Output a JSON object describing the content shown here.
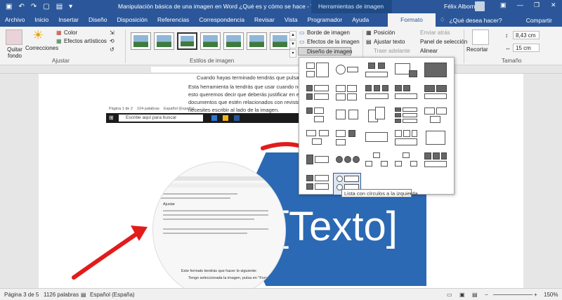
{
  "window": {
    "title": "Manipulación básica de una imagen en Word ¿Qué es y cómo se hace - Word",
    "context_tools": "Herramientas de imagen",
    "user": "Félix Albornoz"
  },
  "tabs": [
    "Archivo",
    "Inicio",
    "Insertar",
    "Diseño",
    "Disposición",
    "Referencias",
    "Correspondencia",
    "Revisar",
    "Vista",
    "Programador",
    "Ayuda",
    "Formato"
  ],
  "tab_search": "¿Qué desea hacer?",
  "share": "Compartir",
  "ribbon": {
    "quitar_fondo": [
      "Quitar",
      "fondo"
    ],
    "correcciones": "Correcciones",
    "color": "Color",
    "efectos_artisticos": "Efectos artísticos",
    "ajustar_label": "Ajustar",
    "estilos_label": "Estilos de imagen",
    "borde_imagen": "Borde de imagen",
    "efectos_imagen": "Efectos de la imagen",
    "diseno_imagen": "Diseño de imagen",
    "posicion": "Posición",
    "ajustar_texto": "Ajustar texto",
    "traer_adelante": "Traer adelante",
    "enviar_atras": "Enviar atrás",
    "panel_seleccion": "Panel de selección",
    "alinear": "Alinear",
    "recortar": "Recortar",
    "height": "8,43 cm",
    "width": "15 cm",
    "tamano_label": "Tamaño"
  },
  "document": {
    "line1": "Cuando hayas terminado tendrás que pulsar en",
    "line2": "Esta herramienta la tendrás que usar cuando necesites",
    "line3": "esto queremos decir que deberás justificar en el medio",
    "line4": "documentos que estén relacionados con revistas, cuen",
    "line5": "necesites escribir al lado de la imagen.",
    "mini_status": [
      "Página 1 de 2",
      "104 palabras",
      "Español (España)"
    ],
    "taskbar_search": "Escribe aquí para buscar",
    "placeholder": "[Texto]",
    "circle_heading": "Ajustar",
    "circle_bottom": "Este formato tendrás que hacer lo siguiente:",
    "circle_bottom2": "Tengo seleccionada la imagen, pulsa en \"Formato\""
  },
  "tooltip": "Lista con círculos a la izquierda",
  "status": {
    "page": "Página 3 de 5",
    "words": "1126 palabras",
    "language": "Español (España)",
    "zoom": "150%"
  }
}
